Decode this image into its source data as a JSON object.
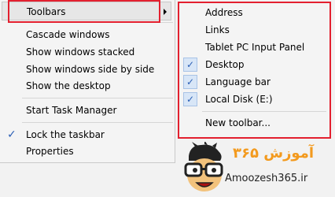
{
  "main_menu": {
    "items": [
      {
        "label": "Toolbars",
        "checked": false
      },
      {
        "label": "Cascade windows",
        "checked": false
      },
      {
        "label": "Show windows stacked",
        "checked": false
      },
      {
        "label": "Show windows side by side",
        "checked": false
      },
      {
        "label": "Show the desktop",
        "checked": false
      },
      {
        "label": "Start Task Manager",
        "checked": false
      },
      {
        "label": "Lock the taskbar",
        "checked": true
      },
      {
        "label": "Properties",
        "checked": false
      }
    ],
    "check_glyph": "✓"
  },
  "toolbars_submenu": {
    "items": [
      {
        "label": "Address",
        "checked": false
      },
      {
        "label": "Links",
        "checked": false
      },
      {
        "label": "Tablet PC Input Panel",
        "checked": false
      },
      {
        "label": "Desktop",
        "checked": true
      },
      {
        "label": "Language bar",
        "checked": true
      },
      {
        "label": "Local Disk (E:)",
        "checked": true
      },
      {
        "label": "New toolbar...",
        "checked": false
      }
    ],
    "check_glyph": "✓"
  },
  "watermark": {
    "text_fa": "آموزش ۳۶۵",
    "text_en": "Amoozesh365.ir"
  },
  "colors": {
    "highlight_box": "#e3202f",
    "check": "#2b5fb5",
    "logo_orange": "#f39a1e"
  }
}
